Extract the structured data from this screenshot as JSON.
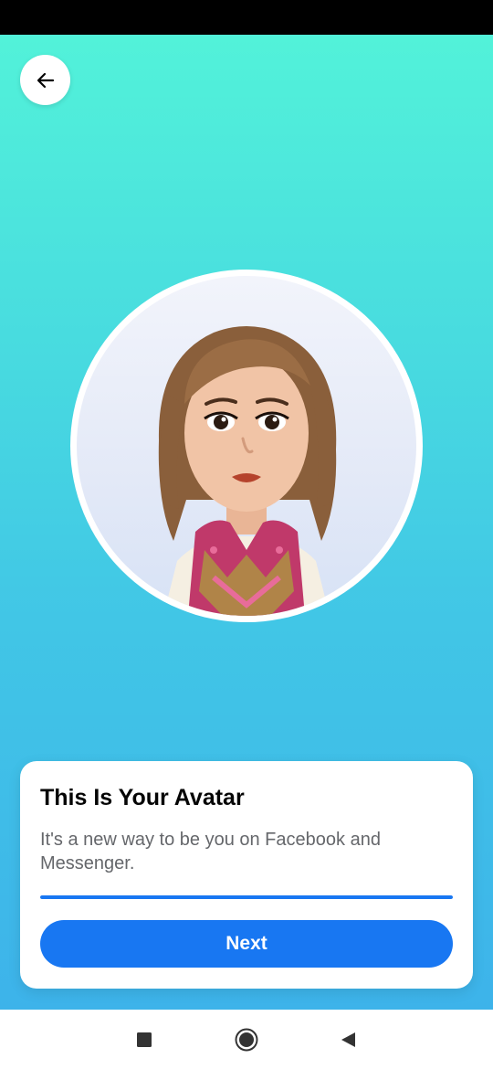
{
  "header": {
    "back_icon": "arrow-left-icon"
  },
  "avatar": {
    "image_desc": "cartoon-avatar-woman-brown-bob-hair-scarf"
  },
  "card": {
    "title": "This Is Your Avatar",
    "subtitle": "It's a new way to be you on Facebook and Messenger.",
    "progress_fraction": 1.0,
    "next_label": "Next"
  },
  "nav": {
    "recents_icon": "square-recents-icon",
    "home_icon": "circle-home-icon",
    "back_icon": "triangle-back-icon"
  },
  "colors": {
    "accent": "#1877f2",
    "gradient_top": "#52f2d9",
    "gradient_bottom": "#3db3ea"
  }
}
